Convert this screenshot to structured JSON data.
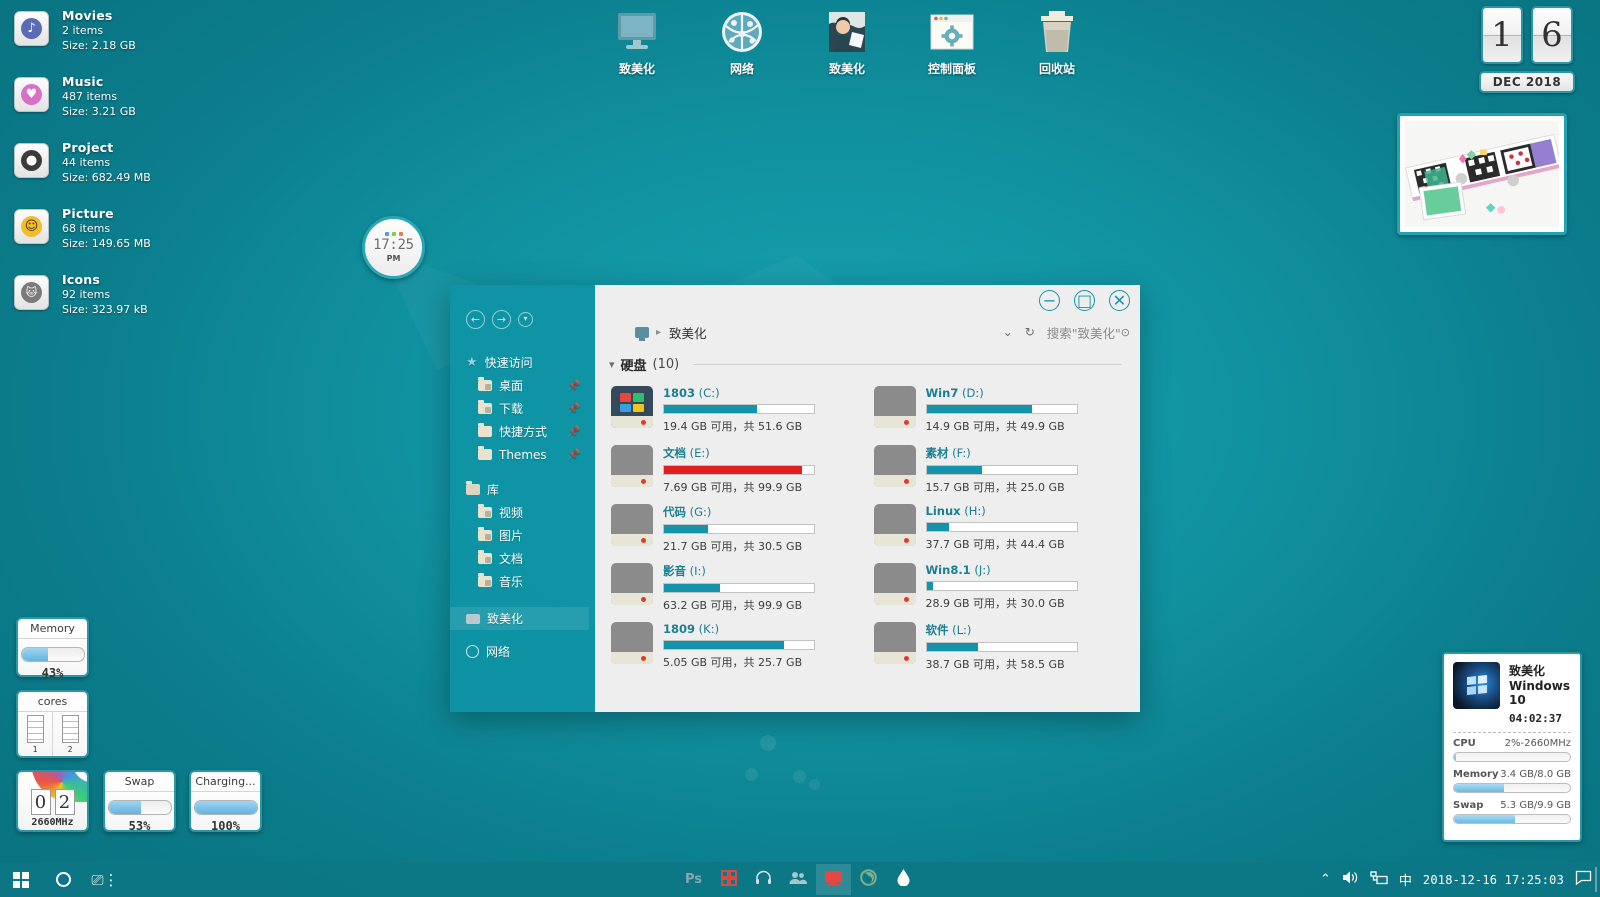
{
  "desktop": {
    "folders": [
      {
        "name": "Movies",
        "items": "2 items",
        "size": "Size: 2.18 GB",
        "icon": "music-note-icon",
        "color": "#5b6bb5",
        "glyph": "♪"
      },
      {
        "name": "Music",
        "items": "487 items",
        "size": "Size: 3.21 GB",
        "icon": "heart-icon",
        "color": "#d96fc8",
        "glyph": "♥"
      },
      {
        "name": "Project",
        "items": "44 items",
        "size": "Size: 682.49 MB",
        "icon": "disc-icon",
        "color": "#3b3b3b",
        "glyph": "●"
      },
      {
        "name": "Picture",
        "items": "68 items",
        "size": "Size: 149.65 MB",
        "icon": "smiley-icon",
        "color": "#f4bb2a",
        "glyph": "☺"
      },
      {
        "name": "Icons",
        "items": "92 items",
        "size": "Size: 323.97 kB",
        "icon": "cat-icon",
        "color": "#7a7a7a",
        "glyph": "▲"
      }
    ],
    "icons": [
      {
        "label": "致美化",
        "icon": "this-pc-monitor-icon"
      },
      {
        "label": "网络",
        "icon": "network-globe-icon"
      },
      {
        "label": "致美化",
        "icon": "user-profile-icon"
      },
      {
        "label": "控制面板",
        "icon": "control-panel-icon"
      },
      {
        "label": "回收站",
        "icon": "recycle-bin-icon"
      }
    ]
  },
  "flip_date": {
    "day_tens": "1",
    "day_ones": "6",
    "month_year": "DEC 2018"
  },
  "clock_widget": {
    "time": "17:25",
    "ampm": "PM",
    "dot_colors": [
      "#4d9fe0",
      "#8cc64a",
      "#f07c3c"
    ]
  },
  "gauges": {
    "memory": {
      "title": "Memory",
      "value": "43%",
      "percent": 43
    },
    "cores": {
      "title": "cores",
      "labels": [
        "1",
        "2"
      ]
    },
    "cpu": {
      "digits": [
        "0",
        "2"
      ],
      "freq": "2660MHz"
    },
    "swap": {
      "title": "Swap",
      "value": "53%",
      "percent": 53
    },
    "battery": {
      "title": "Charging...",
      "value": "100%",
      "percent": 100
    }
  },
  "sysinfo": {
    "name": "致美化",
    "os": "Windows 10",
    "uptime": "04:02:37",
    "rows": [
      {
        "key": "CPU",
        "value": "2%-2660MHz",
        "percent": 2
      },
      {
        "key": "Memory",
        "value": "3.4 GB/8.0 GB",
        "percent": 43
      },
      {
        "key": "Swap",
        "value": "5.3 GB/9.9 GB",
        "percent": 53
      }
    ]
  },
  "explorer": {
    "window_buttons": {
      "minimize": "−",
      "maximize": "□",
      "close": "✕"
    },
    "nav": {
      "back": "←",
      "forward": "→",
      "recent": "⌄"
    },
    "address": {
      "crumb": "致美化",
      "sep": "▸",
      "chevron": "⌄",
      "refresh": "↻",
      "search_placeholder": "搜索\"致美化\"",
      "options": "⊙"
    },
    "sidebar": {
      "quick_access": {
        "label": "快速访问",
        "icon": "star-icon"
      },
      "quick_items": [
        {
          "label": "桌面",
          "pinned": true
        },
        {
          "label": "下载",
          "pinned": true
        },
        {
          "label": "快捷方式",
          "pinned": true
        },
        {
          "label": "Themes",
          "pinned": true
        }
      ],
      "library": {
        "label": "库",
        "icon": "library-icon"
      },
      "library_items": [
        {
          "label": "视频"
        },
        {
          "label": "图片"
        },
        {
          "label": "文档"
        },
        {
          "label": "音乐"
        }
      ],
      "this_pc": {
        "label": "致美化",
        "icon": "monitor-icon"
      },
      "network": {
        "label": "网络",
        "icon": "network-icon"
      }
    },
    "group": {
      "name": "硬盘",
      "count": "(10)"
    },
    "drives": [
      {
        "name": "1803",
        "letter": "(C:)",
        "free": "19.4 GB 可用，共 51.6 GB",
        "used_percent": 62,
        "alert": false,
        "win_logo": true
      },
      {
        "name": "Win7",
        "letter": "(D:)",
        "free": "14.9 GB 可用，共 49.9 GB",
        "used_percent": 70,
        "alert": false,
        "win_logo": false
      },
      {
        "name": "文档",
        "letter": "(E:)",
        "free": "7.69 GB 可用，共 99.9 GB",
        "used_percent": 92,
        "alert": true,
        "win_logo": false
      },
      {
        "name": "素材",
        "letter": "(F:)",
        "free": "15.7 GB 可用，共 25.0 GB",
        "used_percent": 37,
        "alert": false,
        "win_logo": false
      },
      {
        "name": "代码",
        "letter": "(G:)",
        "free": "21.7 GB 可用，共 30.5 GB",
        "used_percent": 29,
        "alert": false,
        "win_logo": false
      },
      {
        "name": "Linux",
        "letter": "(H:)",
        "free": "37.7 GB 可用，共 44.4 GB",
        "used_percent": 15,
        "alert": false,
        "win_logo": false
      },
      {
        "name": "影音",
        "letter": "(I:)",
        "free": "63.2 GB 可用，共 99.9 GB",
        "used_percent": 37,
        "alert": false,
        "win_logo": false
      },
      {
        "name": "Win8.1",
        "letter": "(J:)",
        "free": "28.9 GB 可用，共 30.0 GB",
        "used_percent": 4,
        "alert": false,
        "win_logo": false
      },
      {
        "name": "1809",
        "letter": "(K:)",
        "free": "5.05 GB 可用，共 25.7 GB",
        "used_percent": 80,
        "alert": false,
        "win_logo": false
      },
      {
        "name": "软件",
        "letter": "(L:)",
        "free": "38.7 GB 可用，共 58.5 GB",
        "used_percent": 34,
        "alert": false,
        "win_logo": false
      }
    ]
  },
  "taskbar": {
    "start": "start-button",
    "search": "cortana-circle-icon",
    "taskview": "task-view-icon",
    "apps": [
      {
        "name": "photoshop",
        "glyph": "Ps",
        "color": "#8aa7ad",
        "active": false
      },
      {
        "name": "qr-app",
        "glyph": "☷",
        "color": "#e8473f",
        "active": false
      },
      {
        "name": "headphones",
        "glyph": "♫",
        "color": "#cfe0e3",
        "active": false
      },
      {
        "name": "people",
        "glyph": "☻",
        "color": "#a9c6cc",
        "active": false
      },
      {
        "name": "file-explorer",
        "glyph": "▭",
        "color": "#e8473f",
        "active": true
      },
      {
        "name": "chrome",
        "glyph": "◎",
        "color": "#7fae8c",
        "active": false
      },
      {
        "name": "rainmeter",
        "glyph": "◆",
        "color": "#ffffff",
        "active": false
      }
    ],
    "tray": {
      "chevron": "⌃",
      "volume": "volume-icon",
      "network": "network-tray-icon",
      "ime": "中",
      "datetime": "2018-12-16  17:25:03",
      "action_center": "action-center-icon"
    }
  },
  "colors": {
    "accent": "#1593ab",
    "alert": "#e02020",
    "desktop_bg": "#11919f"
  }
}
